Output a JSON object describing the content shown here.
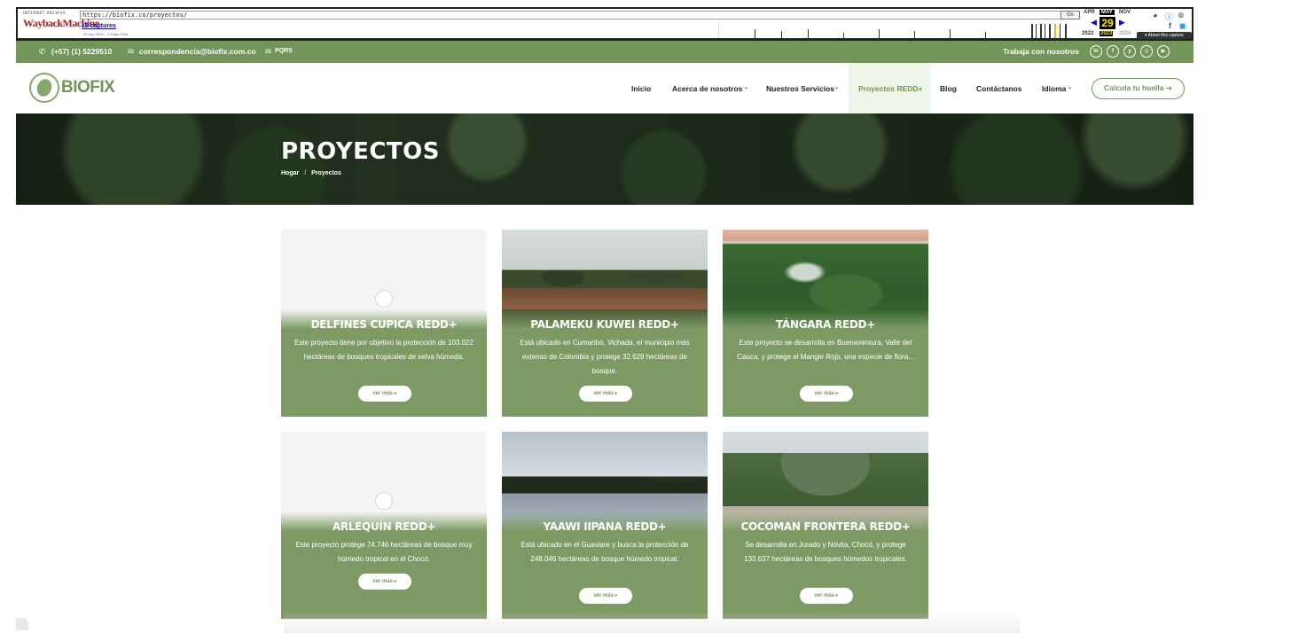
{
  "wayback": {
    "logo_top": "INTERNET ARCHIVE",
    "logo_main": "WaybackMachine",
    "url": "https://biofix.co/proyectos/",
    "go_label": "Go",
    "captures": "15 captures",
    "range": "19 Sep 2020 – 13 May 2024",
    "month_prev": "APR",
    "month_cur": "MAY",
    "month_next": "NOV",
    "day": "29",
    "year_prev": "2022",
    "year_cur": "2023",
    "year_next": "2024",
    "about": "▾ About this capture"
  },
  "topbar": {
    "phone": "(+57) (1) 5229510",
    "email": "correspondencia@biofix.com.co",
    "pqrs": "PQRS",
    "work": "Trabaja con nosotros",
    "social": [
      "in",
      "f",
      "y",
      "◎",
      "▶"
    ]
  },
  "nav": {
    "logo": "BIOFIX",
    "items": [
      "Inicio",
      "Acerca de nosotros",
      "Nuestros Servicios",
      "Proyectos REDD+",
      "Blog",
      "Contáctanos",
      "Idioma"
    ],
    "cta": "Calcula tu huella"
  },
  "hero": {
    "title": "PROYECTOS",
    "crumb_home": "Hogar",
    "crumb_sep": "/",
    "crumb_current": "Proyectos"
  },
  "cards": [
    {
      "title": "DELFINES CUPICA REDD+",
      "desc": "Este proyecto tiene por objetivo la protección de 103.022 hectáreas de bosques tropicales de selva húmeda.",
      "button": "ver más"
    },
    {
      "title": "PALAMEKU KUWEI REDD+",
      "desc": "Está ubicado en Cumaribo, Vichada, el municipio más extenso de Colombia y protege 32.629 hectáreas de bosque.",
      "button": "ver más"
    },
    {
      "title": "TÁNGARA REDD+",
      "desc": "Este proyecto se desarrolla en Buenaventura, Valle del Cauca, y protege el Mangle Rojo, una especie de flora...",
      "button": "ver más"
    },
    {
      "title": "ARLEQUÍN REDD+",
      "desc": "Este proyecto protege 74.746 hectáreas de bosque muy húmedo tropical en el Chocó.",
      "button": "ver más"
    },
    {
      "title": "YAAWI IIPANA REDD+",
      "desc": "Está ubicado en el Guaviare y busca la protección de 248.046 hectáreas de bosque húmedo tropical.",
      "button": "ver más"
    },
    {
      "title": "COCOMAN FRONTERA REDD+",
      "desc": "Se desarrolla en Jurado y Nóvita, Chocó, y protege 133.637 hectáreas de bosques húmedos tropicales.",
      "button": "ver más"
    }
  ],
  "colors": {
    "brand_green": "#72955a",
    "card_green": "#7d9a64"
  }
}
